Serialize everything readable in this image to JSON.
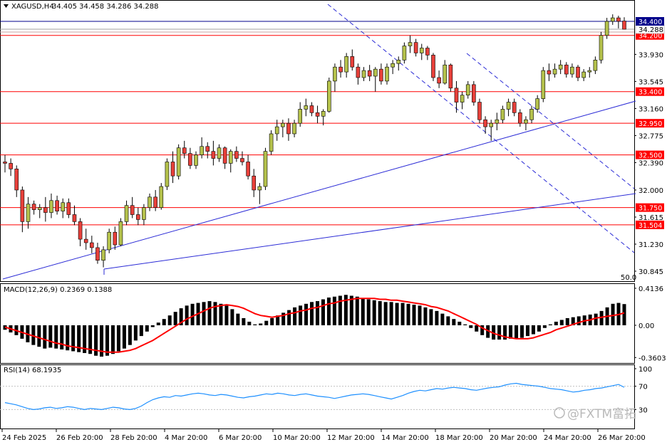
{
  "header": {
    "symbol": "XAGUSD,H4",
    "ohlc": "34.405 34.458 34.286 34.288",
    "menu_icon": "triangle-down-icon"
  },
  "colors": {
    "bull": "#b5c24c",
    "bear": "#e8403a",
    "level_line": "#ff0000",
    "trend_line": "#2b2bd6",
    "macd_signal": "#ff0000",
    "rsi_line": "#1e90ff",
    "bid": "#00008b",
    "ask": "#ff0000"
  },
  "chart_data": [
    {
      "type": "candlestick",
      "panel": "price",
      "symbol": "XAGUSD",
      "timeframe": "H4",
      "ylim": [
        30.7,
        34.55
      ],
      "y_ticks": [
        "33.930",
        "33.545",
        "33.160",
        "32.775",
        "32.390",
        "32.000",
        "31.615",
        "31.230",
        "30.845"
      ],
      "x_ticks": [
        "24 Feb 2025",
        "26 Feb 20:00",
        "28 Feb 20:00",
        "4 Mar 20:00",
        "6 Mar 20:00",
        "10 Mar 20:00",
        "12 Mar 20:00",
        "14 Mar 20:00",
        "18 Mar 20:00",
        "20 Mar 20:00",
        "24 Mar 20:00",
        "26 Mar 20:00"
      ],
      "corner_label": "50.0",
      "horizontal_levels": [
        "34.400",
        "34.200",
        "33.400",
        "32.950",
        "32.500",
        "31.750",
        "31.504"
      ],
      "current_price": "34.288",
      "candles": [
        {
          "o": 32.4,
          "h": 32.5,
          "l": 32.25,
          "c": 32.38
        },
        {
          "o": 32.38,
          "h": 32.45,
          "l": 32.2,
          "c": 32.3
        },
        {
          "o": 32.3,
          "h": 32.35,
          "l": 31.9,
          "c": 32.0
        },
        {
          "o": 32.0,
          "h": 32.05,
          "l": 31.4,
          "c": 31.55
        },
        {
          "o": 31.55,
          "h": 31.9,
          "l": 31.45,
          "c": 31.8
        },
        {
          "o": 31.8,
          "h": 31.85,
          "l": 31.65,
          "c": 31.72
        },
        {
          "o": 31.72,
          "h": 31.8,
          "l": 31.6,
          "c": 31.75
        },
        {
          "o": 31.75,
          "h": 31.9,
          "l": 31.55,
          "c": 31.68
        },
        {
          "o": 31.68,
          "h": 31.95,
          "l": 31.6,
          "c": 31.85
        },
        {
          "o": 31.85,
          "h": 31.92,
          "l": 31.65,
          "c": 31.7
        },
        {
          "o": 31.7,
          "h": 31.88,
          "l": 31.6,
          "c": 31.82
        },
        {
          "o": 31.82,
          "h": 31.88,
          "l": 31.6,
          "c": 31.65
        },
        {
          "o": 31.65,
          "h": 31.78,
          "l": 31.5,
          "c": 31.55
        },
        {
          "o": 31.55,
          "h": 31.6,
          "l": 31.2,
          "c": 31.3
        },
        {
          "o": 31.3,
          "h": 31.45,
          "l": 31.15,
          "c": 31.25
        },
        {
          "o": 31.25,
          "h": 31.35,
          "l": 31.1,
          "c": 31.18
        },
        {
          "o": 31.18,
          "h": 31.25,
          "l": 30.95,
          "c": 31.0
        },
        {
          "o": 31.0,
          "h": 31.2,
          "l": 30.9,
          "c": 31.15
        },
        {
          "o": 31.15,
          "h": 31.45,
          "l": 31.1,
          "c": 31.4
        },
        {
          "o": 31.4,
          "h": 31.48,
          "l": 31.15,
          "c": 31.22
        },
        {
          "o": 31.22,
          "h": 31.6,
          "l": 31.2,
          "c": 31.55
        },
        {
          "o": 31.55,
          "h": 31.85,
          "l": 31.5,
          "c": 31.78
        },
        {
          "o": 31.78,
          "h": 31.9,
          "l": 31.6,
          "c": 31.65
        },
        {
          "o": 31.65,
          "h": 31.75,
          "l": 31.5,
          "c": 31.58
        },
        {
          "o": 31.58,
          "h": 31.8,
          "l": 31.5,
          "c": 31.75
        },
        {
          "o": 31.75,
          "h": 31.95,
          "l": 31.7,
          "c": 31.9
        },
        {
          "o": 31.9,
          "h": 32.0,
          "l": 31.7,
          "c": 31.75
        },
        {
          "o": 31.75,
          "h": 32.1,
          "l": 31.72,
          "c": 32.05
        },
        {
          "o": 32.05,
          "h": 32.45,
          "l": 32.0,
          "c": 32.4
        },
        {
          "o": 32.4,
          "h": 32.55,
          "l": 32.1,
          "c": 32.2
        },
        {
          "o": 32.2,
          "h": 32.65,
          "l": 32.15,
          "c": 32.6
        },
        {
          "o": 32.6,
          "h": 32.7,
          "l": 32.45,
          "c": 32.52
        },
        {
          "o": 32.52,
          "h": 32.6,
          "l": 32.3,
          "c": 32.35
        },
        {
          "o": 32.35,
          "h": 32.55,
          "l": 32.3,
          "c": 32.5
        },
        {
          "o": 32.5,
          "h": 32.75,
          "l": 32.45,
          "c": 32.62
        },
        {
          "o": 32.62,
          "h": 32.68,
          "l": 32.45,
          "c": 32.55
        },
        {
          "o": 32.55,
          "h": 32.7,
          "l": 32.35,
          "c": 32.45
        },
        {
          "o": 32.45,
          "h": 32.65,
          "l": 32.4,
          "c": 32.6
        },
        {
          "o": 32.6,
          "h": 32.62,
          "l": 32.3,
          "c": 32.38
        },
        {
          "o": 32.38,
          "h": 32.58,
          "l": 32.25,
          "c": 32.55
        },
        {
          "o": 32.55,
          "h": 32.62,
          "l": 32.4,
          "c": 32.45
        },
        {
          "o": 32.45,
          "h": 32.55,
          "l": 32.35,
          "c": 32.4
        },
        {
          "o": 32.4,
          "h": 32.5,
          "l": 32.15,
          "c": 32.2
        },
        {
          "o": 32.2,
          "h": 32.3,
          "l": 31.9,
          "c": 32.0
        },
        {
          "o": 32.0,
          "h": 32.1,
          "l": 31.8,
          "c": 32.05
        },
        {
          "o": 32.05,
          "h": 32.6,
          "l": 32.0,
          "c": 32.55
        },
        {
          "o": 32.55,
          "h": 32.85,
          "l": 32.5,
          "c": 32.8
        },
        {
          "o": 32.8,
          "h": 33.0,
          "l": 32.7,
          "c": 32.9
        },
        {
          "o": 32.9,
          "h": 33.0,
          "l": 32.75,
          "c": 32.95
        },
        {
          "o": 32.95,
          "h": 33.02,
          "l": 32.7,
          "c": 32.8
        },
        {
          "o": 32.8,
          "h": 33.0,
          "l": 32.75,
          "c": 32.95
        },
        {
          "o": 32.95,
          "h": 33.25,
          "l": 32.9,
          "c": 33.15
        },
        {
          "o": 33.15,
          "h": 33.3,
          "l": 33.05,
          "c": 33.2
        },
        {
          "o": 33.2,
          "h": 33.25,
          "l": 33.05,
          "c": 33.1
        },
        {
          "o": 33.1,
          "h": 33.2,
          "l": 32.95,
          "c": 33.05
        },
        {
          "o": 33.05,
          "h": 33.15,
          "l": 32.92,
          "c": 33.12
        },
        {
          "o": 33.12,
          "h": 33.6,
          "l": 33.1,
          "c": 33.55
        },
        {
          "o": 33.55,
          "h": 33.8,
          "l": 33.4,
          "c": 33.75
        },
        {
          "o": 33.75,
          "h": 33.85,
          "l": 33.6,
          "c": 33.68
        },
        {
          "o": 33.68,
          "h": 33.95,
          "l": 33.6,
          "c": 33.9
        },
        {
          "o": 33.9,
          "h": 34.0,
          "l": 33.7,
          "c": 33.75
        },
        {
          "o": 33.75,
          "h": 33.8,
          "l": 33.5,
          "c": 33.6
        },
        {
          "o": 33.6,
          "h": 33.75,
          "l": 33.55,
          "c": 33.7
        },
        {
          "o": 33.7,
          "h": 33.78,
          "l": 33.55,
          "c": 33.62
        },
        {
          "o": 33.62,
          "h": 33.75,
          "l": 33.4,
          "c": 33.72
        },
        {
          "o": 33.72,
          "h": 33.8,
          "l": 33.5,
          "c": 33.55
        },
        {
          "o": 33.55,
          "h": 33.8,
          "l": 33.5,
          "c": 33.75
        },
        {
          "o": 33.75,
          "h": 33.85,
          "l": 33.65,
          "c": 33.8
        },
        {
          "o": 33.8,
          "h": 33.9,
          "l": 33.7,
          "c": 33.85
        },
        {
          "o": 33.85,
          "h": 34.1,
          "l": 33.8,
          "c": 34.05
        },
        {
          "o": 34.05,
          "h": 34.2,
          "l": 33.95,
          "c": 34.1
        },
        {
          "o": 34.1,
          "h": 34.15,
          "l": 33.9,
          "c": 33.95
        },
        {
          "o": 33.95,
          "h": 34.08,
          "l": 33.85,
          "c": 34.02
        },
        {
          "o": 34.02,
          "h": 34.05,
          "l": 33.85,
          "c": 33.92
        },
        {
          "o": 33.92,
          "h": 33.95,
          "l": 33.55,
          "c": 33.6
        },
        {
          "o": 33.6,
          "h": 33.7,
          "l": 33.45,
          "c": 33.52
        },
        {
          "o": 33.52,
          "h": 33.85,
          "l": 33.5,
          "c": 33.78
        },
        {
          "o": 33.78,
          "h": 33.8,
          "l": 33.4,
          "c": 33.45
        },
        {
          "o": 33.45,
          "h": 33.55,
          "l": 33.1,
          "c": 33.25
        },
        {
          "o": 33.25,
          "h": 33.4,
          "l": 33.15,
          "c": 33.35
        },
        {
          "o": 33.35,
          "h": 33.55,
          "l": 33.3,
          "c": 33.5
        },
        {
          "o": 33.5,
          "h": 33.55,
          "l": 33.2,
          "c": 33.25
        },
        {
          "o": 33.25,
          "h": 33.3,
          "l": 32.95,
          "c": 33.0
        },
        {
          "o": 33.0,
          "h": 33.05,
          "l": 32.8,
          "c": 32.9
        },
        {
          "o": 32.9,
          "h": 33.0,
          "l": 32.7,
          "c": 32.95
        },
        {
          "o": 32.95,
          "h": 33.1,
          "l": 32.85,
          "c": 33.0
        },
        {
          "o": 33.0,
          "h": 33.2,
          "l": 32.95,
          "c": 33.15
        },
        {
          "o": 33.15,
          "h": 33.3,
          "l": 33.05,
          "c": 33.25
        },
        {
          "o": 33.25,
          "h": 33.3,
          "l": 33.05,
          "c": 33.1
        },
        {
          "o": 33.1,
          "h": 33.15,
          "l": 32.9,
          "c": 32.95
        },
        {
          "o": 32.95,
          "h": 33.05,
          "l": 32.85,
          "c": 33.0
        },
        {
          "o": 33.0,
          "h": 33.2,
          "l": 32.95,
          "c": 33.15
        },
        {
          "o": 33.15,
          "h": 33.35,
          "l": 33.1,
          "c": 33.3
        },
        {
          "o": 33.3,
          "h": 33.75,
          "l": 33.25,
          "c": 33.7
        },
        {
          "o": 33.7,
          "h": 33.8,
          "l": 33.55,
          "c": 33.65
        },
        {
          "o": 33.65,
          "h": 33.8,
          "l": 33.6,
          "c": 33.72
        },
        {
          "o": 33.72,
          "h": 33.85,
          "l": 33.65,
          "c": 33.78
        },
        {
          "o": 33.78,
          "h": 33.82,
          "l": 33.6,
          "c": 33.65
        },
        {
          "o": 33.65,
          "h": 33.8,
          "l": 33.6,
          "c": 33.75
        },
        {
          "o": 33.75,
          "h": 33.78,
          "l": 33.55,
          "c": 33.6
        },
        {
          "o": 33.6,
          "h": 33.72,
          "l": 33.55,
          "c": 33.68
        },
        {
          "o": 33.68,
          "h": 33.75,
          "l": 33.6,
          "c": 33.7
        },
        {
          "o": 33.7,
          "h": 33.9,
          "l": 33.65,
          "c": 33.85
        },
        {
          "o": 33.85,
          "h": 34.25,
          "l": 33.8,
          "c": 34.2
        },
        {
          "o": 34.2,
          "h": 34.45,
          "l": 34.15,
          "c": 34.4
        },
        {
          "o": 34.4,
          "h": 34.5,
          "l": 34.35,
          "c": 34.45
        },
        {
          "o": 34.45,
          "h": 34.48,
          "l": 34.3,
          "c": 34.4
        },
        {
          "o": 34.405,
          "h": 34.458,
          "l": 34.286,
          "c": 34.288
        }
      ]
    },
    {
      "type": "bar+line",
      "panel": "macd",
      "title": "MACD(12,26,9) 0.2369 0.1388",
      "y_ticks": [
        "0.4136",
        "0.00",
        "-0.3603"
      ],
      "ylim": [
        -0.4,
        0.45
      ],
      "histogram": [
        -0.05,
        -0.08,
        -0.11,
        -0.15,
        -0.19,
        -0.22,
        -0.24,
        -0.26,
        -0.25,
        -0.26,
        -0.27,
        -0.28,
        -0.29,
        -0.3,
        -0.31,
        -0.32,
        -0.34,
        -0.35,
        -0.34,
        -0.32,
        -0.29,
        -0.26,
        -0.22,
        -0.17,
        -0.12,
        -0.07,
        -0.02,
        0.03,
        0.07,
        0.11,
        0.15,
        0.19,
        0.22,
        0.24,
        0.25,
        0.26,
        0.27,
        0.26,
        0.24,
        0.22,
        0.18,
        0.13,
        0.08,
        0.04,
        0.01,
        0.02,
        0.05,
        0.08,
        0.11,
        0.14,
        0.17,
        0.2,
        0.22,
        0.24,
        0.26,
        0.27,
        0.29,
        0.31,
        0.32,
        0.33,
        0.34,
        0.33,
        0.32,
        0.3,
        0.29,
        0.28,
        0.27,
        0.26,
        0.26,
        0.25,
        0.25,
        0.24,
        0.23,
        0.22,
        0.2,
        0.18,
        0.16,
        0.13,
        0.1,
        0.07,
        0.04,
        0.01,
        -0.03,
        -0.07,
        -0.11,
        -0.14,
        -0.16,
        -0.16,
        -0.16,
        -0.15,
        -0.15,
        -0.14,
        -0.12,
        -0.1,
        -0.07,
        -0.03,
        0.01,
        0.04,
        0.06,
        0.08,
        0.09,
        0.1,
        0.11,
        0.12,
        0.13,
        0.16,
        0.2,
        0.24,
        0.25,
        0.2369
      ],
      "signal": [
        -0.02,
        -0.04,
        -0.06,
        -0.08,
        -0.1,
        -0.12,
        -0.14,
        -0.16,
        -0.18,
        -0.2,
        -0.21,
        -0.23,
        -0.24,
        -0.25,
        -0.26,
        -0.27,
        -0.28,
        -0.29,
        -0.3,
        -0.3,
        -0.3,
        -0.29,
        -0.28,
        -0.26,
        -0.23,
        -0.2,
        -0.17,
        -0.13,
        -0.09,
        -0.05,
        -0.01,
        0.03,
        0.07,
        0.1,
        0.13,
        0.16,
        0.19,
        0.21,
        0.22,
        0.23,
        0.22,
        0.21,
        0.19,
        0.16,
        0.13,
        0.11,
        0.1,
        0.09,
        0.1,
        0.11,
        0.13,
        0.14,
        0.16,
        0.17,
        0.19,
        0.2,
        0.22,
        0.24,
        0.25,
        0.27,
        0.28,
        0.29,
        0.3,
        0.3,
        0.3,
        0.3,
        0.29,
        0.29,
        0.28,
        0.28,
        0.27,
        0.26,
        0.25,
        0.24,
        0.23,
        0.21,
        0.2,
        0.18,
        0.16,
        0.13,
        0.1,
        0.07,
        0.04,
        0.01,
        -0.03,
        -0.06,
        -0.09,
        -0.11,
        -0.13,
        -0.14,
        -0.15,
        -0.15,
        -0.15,
        -0.14,
        -0.12,
        -0.1,
        -0.08,
        -0.05,
        -0.03,
        -0.01,
        0.01,
        0.03,
        0.05,
        0.06,
        0.08,
        0.09,
        0.1,
        0.11,
        0.12,
        0.1388
      ]
    },
    {
      "type": "line",
      "panel": "rsi",
      "title": "RSI(14) 68.1935",
      "y_ticks": [
        "100",
        "70",
        "30",
        "0"
      ],
      "ylim": [
        0,
        100
      ],
      "values": [
        42,
        40,
        38,
        35,
        32,
        30,
        31,
        33,
        34,
        32,
        33,
        35,
        34,
        32,
        30,
        32,
        31,
        30,
        32,
        34,
        33,
        31,
        30,
        32,
        36,
        42,
        47,
        50,
        52,
        51,
        54,
        53,
        55,
        57,
        58,
        57,
        55,
        54,
        56,
        55,
        53,
        51,
        50,
        52,
        53,
        55,
        57,
        56,
        58,
        57,
        55,
        54,
        56,
        57,
        55,
        53,
        52,
        51,
        49,
        51,
        53,
        55,
        56,
        57,
        56,
        54,
        52,
        50,
        48,
        51,
        54,
        58,
        61,
        63,
        62,
        64,
        66,
        65,
        67,
        68,
        67,
        66,
        64,
        63,
        65,
        67,
        68,
        69,
        72,
        74,
        75,
        73,
        72,
        71,
        70,
        68,
        66,
        65,
        64,
        62,
        60,
        61,
        63,
        64,
        66,
        67,
        69,
        71,
        73,
        68.1935
      ]
    }
  ],
  "watermark": {
    "logo_icon": "fxtm-logo-icon",
    "text": "@FXTM富拓"
  }
}
